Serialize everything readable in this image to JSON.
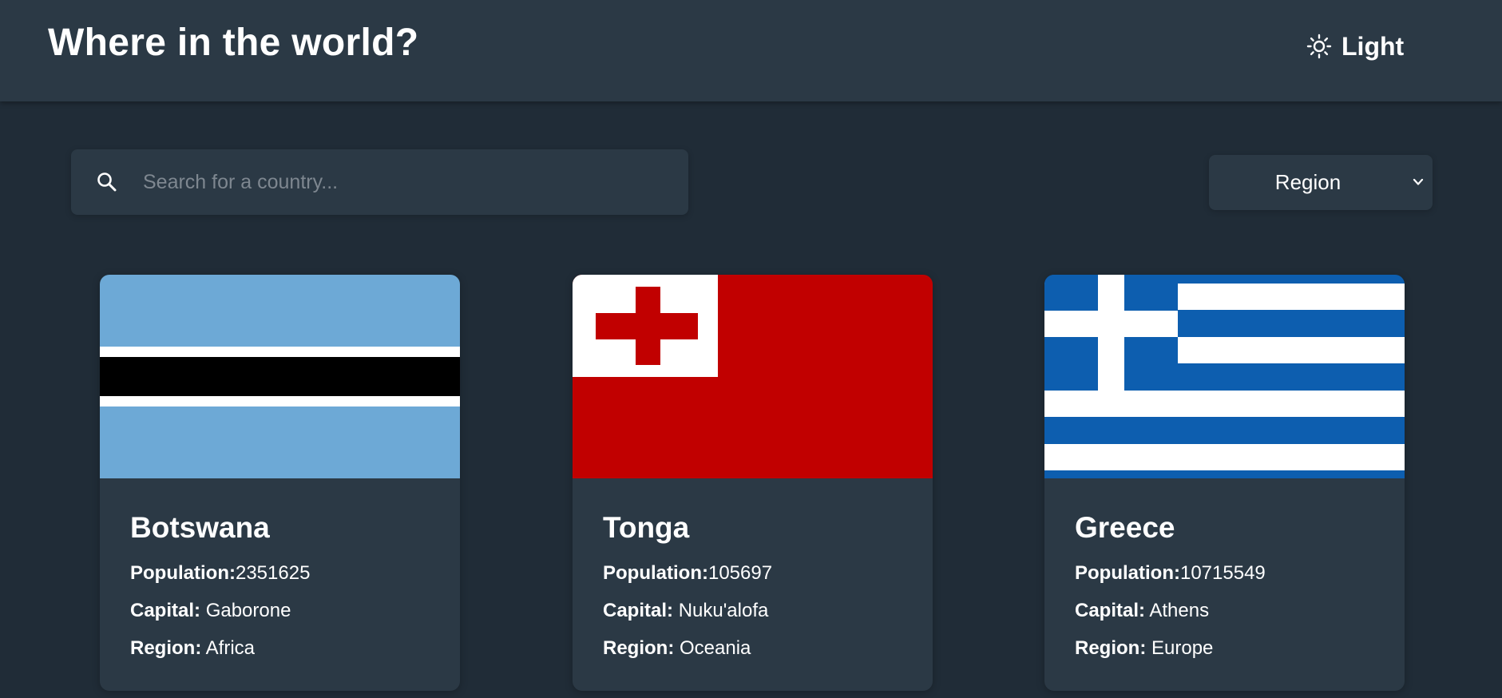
{
  "header": {
    "title": "Where in the world?",
    "theme_toggle": {
      "icon": "sun-icon",
      "label": "Light"
    }
  },
  "search": {
    "icon": "search-icon",
    "placeholder": "Search for a country...",
    "value": ""
  },
  "filter": {
    "label": "Region",
    "icon": "chevron-down-icon"
  },
  "labels": {
    "population": "Population:",
    "capital": "Capital:",
    "region": "Region:"
  },
  "countries": [
    {
      "name": "Botswana",
      "population": "2351625",
      "capital": "Gaborone",
      "region": "Africa",
      "flag_colors": {
        "sky": "#6da9d6",
        "white": "#ffffff",
        "black": "#000000"
      }
    },
    {
      "name": "Tonga",
      "population": "105697",
      "capital": "Nuku'alofa",
      "region": "Oceania",
      "flag_colors": {
        "red": "#c10000",
        "white": "#ffffff"
      }
    },
    {
      "name": "Greece",
      "population": "10715549",
      "capital": "Athens",
      "region": "Europe",
      "flag_colors": {
        "blue": "#0d5eaf",
        "white": "#ffffff"
      }
    }
  ],
  "colors": {
    "background": "#202c37",
    "element": "#2b3945",
    "text": "#ffffff",
    "placeholder": "#7e8790"
  }
}
